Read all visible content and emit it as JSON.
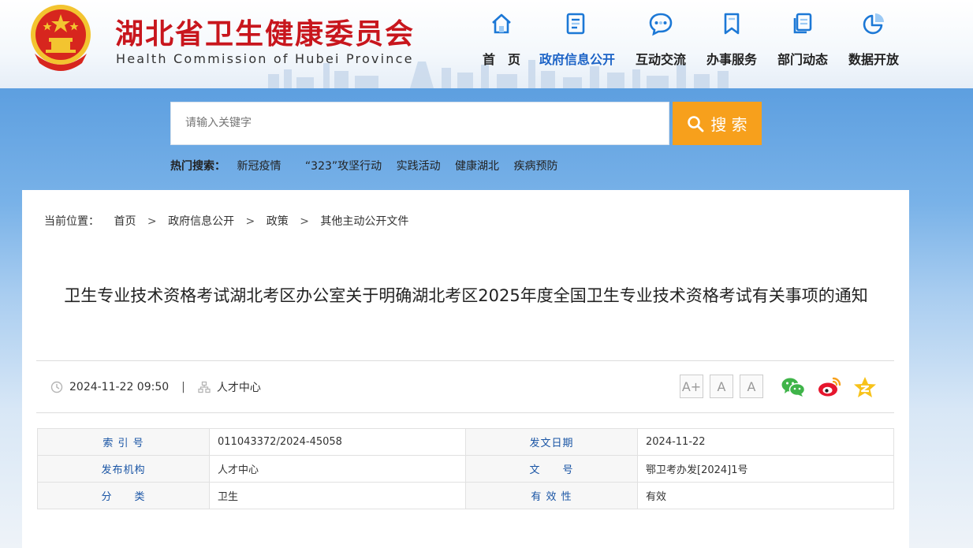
{
  "header": {
    "brand_cn": "湖北省卫生健康委员会",
    "brand_en": "Health Commission of Hubei Province",
    "nav": [
      {
        "label": "首　页",
        "icon": "home-icon"
      },
      {
        "label": "政府信息公开",
        "icon": "document-list-icon",
        "active": true
      },
      {
        "label": "互动交流",
        "icon": "chat-bubble-icon"
      },
      {
        "label": "办事服务",
        "icon": "bookmark-icon"
      },
      {
        "label": "部门动态",
        "icon": "copy-icon"
      },
      {
        "label": "数据开放",
        "icon": "pie-chart-icon"
      }
    ]
  },
  "search": {
    "placeholder": "请输入关键字",
    "button_label": "搜 索",
    "hot_title": "热门搜索：",
    "hot_terms": [
      "新冠疫情",
      "“323”攻坚行动",
      "实践活动",
      "健康湖北",
      "疾病预防"
    ]
  },
  "breadcrumb": {
    "lead": "当前位置：",
    "items": [
      "首页",
      "政府信息公开",
      "政策",
      "其他主动公开文件"
    ],
    "separator": ">"
  },
  "article": {
    "title": "卫生专业技术资格考试湖北考区办公室关于明确湖北考区2025年度全国卫生专业技术资格考试有关事项的通知",
    "datetime": "2024-11-22 09:50",
    "source": "人才中心",
    "pipe": "|"
  },
  "font_sizes": [
    "A+",
    "A",
    "A"
  ],
  "share": [
    "wechat-icon",
    "weibo-icon",
    "qzone-icon"
  ],
  "info_table": [
    {
      "label1": "索 引 号",
      "value1": "011043372/2024-45058",
      "label2": "发文日期",
      "value2": "2024-11-22"
    },
    {
      "label1": "发布机构",
      "value1": "人才中心",
      "label2": "文　　号",
      "value2": "鄂卫考办发[2024]1号"
    },
    {
      "label1": "分　　类",
      "value1": "卫生",
      "label2": "有 效 性",
      "value2": "有效"
    }
  ],
  "colors": {
    "brand_red": "#c8161d",
    "accent_blue": "#1c63c6",
    "search_orange": "#f7a01c"
  }
}
